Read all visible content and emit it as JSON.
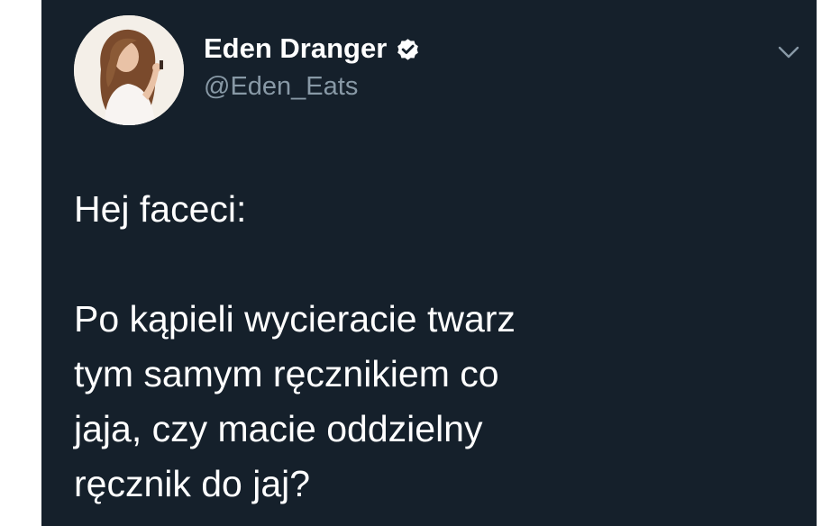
{
  "tweet": {
    "author": {
      "name": "Eden Dranger",
      "handle": "@Eden_Eats",
      "verified": true,
      "avatar_icon": "profile-photo"
    },
    "menu_icon": "chevron-down-icon",
    "greeting": "Hej faceci:",
    "body_lines": [
      "Po kąpieli wycieracie twarz",
      "tym samym ręcznikiem co",
      "jaja, czy macie oddzielny",
      "ręcznik do jaj?"
    ]
  },
  "colors": {
    "background": "#15202b",
    "text_primary": "#ffffff",
    "text_secondary": "#8899a6",
    "verified_badge": "#ffffff"
  }
}
